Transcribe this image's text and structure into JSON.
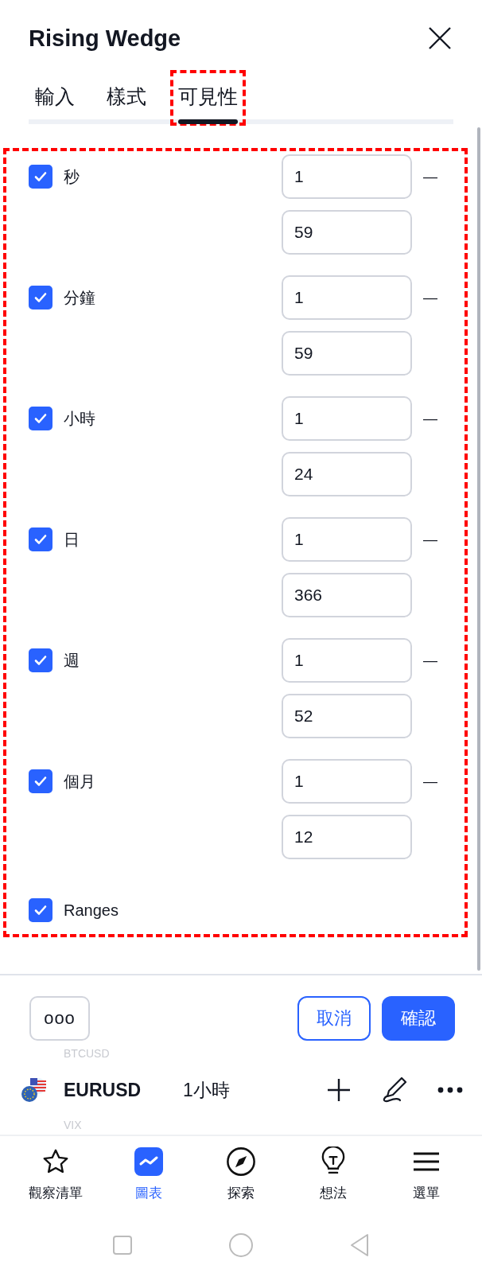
{
  "dialog": {
    "title": "Rising Wedge"
  },
  "tabs": [
    {
      "label": "輸入",
      "selected": false,
      "highlighted": false
    },
    {
      "label": "樣式",
      "selected": false,
      "highlighted": false
    },
    {
      "label": "可見性",
      "selected": true,
      "highlighted": true
    }
  ],
  "settings": {
    "highlighted": true,
    "rows": [
      {
        "kind": "interval",
        "label": "秒",
        "checked": true,
        "from": "1",
        "to": "59"
      },
      {
        "kind": "interval",
        "label": "分鐘",
        "checked": true,
        "from": "1",
        "to": "59"
      },
      {
        "kind": "interval",
        "label": "小時",
        "checked": true,
        "from": "1",
        "to": "24"
      },
      {
        "kind": "interval",
        "label": "日",
        "checked": true,
        "from": "1",
        "to": "366"
      },
      {
        "kind": "interval",
        "label": "週",
        "checked": true,
        "from": "1",
        "to": "52"
      },
      {
        "kind": "interval",
        "label": "個月",
        "checked": true,
        "from": "1",
        "to": "12"
      },
      {
        "kind": "plain",
        "label": "Ranges",
        "checked": true
      }
    ]
  },
  "range_separator": "—",
  "footer": {
    "more": "ooo",
    "cancel": "取消",
    "confirm": "確認"
  },
  "symbol_bar": {
    "previous": "BTCUSD",
    "symbol": "EURUSD",
    "interval": "1小時",
    "next": "VIX"
  },
  "nav": [
    {
      "kind": "star",
      "label": "觀察清單",
      "selected": false
    },
    {
      "kind": "chart",
      "label": "圖表",
      "selected": true
    },
    {
      "kind": "compass",
      "label": "探索",
      "selected": false
    },
    {
      "kind": "bulb",
      "label": "想法",
      "selected": false
    },
    {
      "kind": "menu",
      "label": "選單",
      "selected": false
    }
  ]
}
